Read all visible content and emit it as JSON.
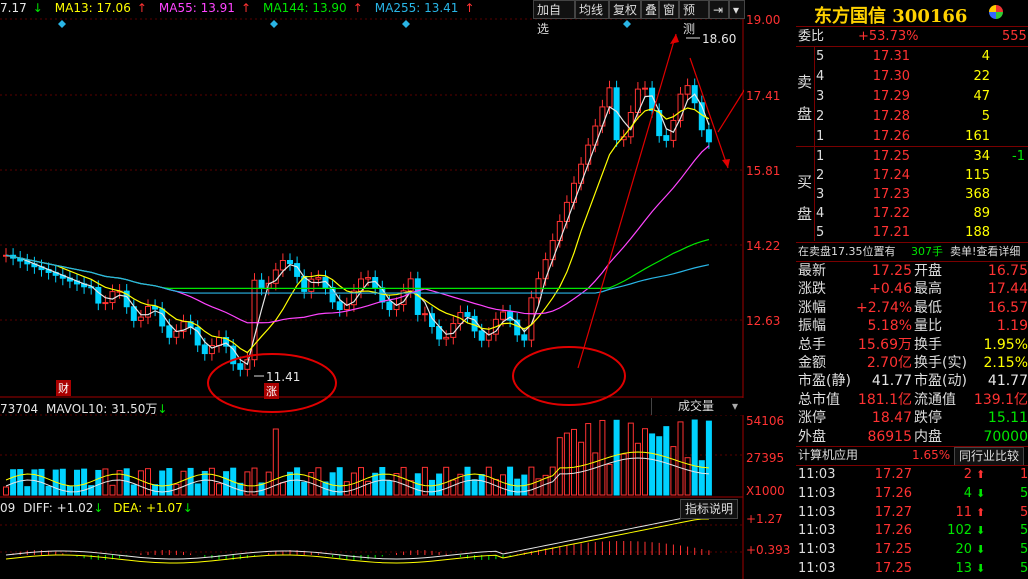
{
  "ma_legend": [
    {
      "label": "7.17",
      "arrow": "↓",
      "color": "#e6e6e6",
      "arrow_color": "#00e600"
    },
    {
      "label": "MA13: 17.06",
      "arrow": "↑",
      "color": "#ffff00",
      "arrow_color": "#ff3232"
    },
    {
      "label": "MA55: 13.91",
      "arrow": "↑",
      "color": "#ff44ff",
      "arrow_color": "#ff3232"
    },
    {
      "label": "MA144: 13.90",
      "arrow": "↑",
      "color": "#00e600",
      "arrow_color": "#ff3232"
    },
    {
      "label": "MA255: 13.41",
      "arrow": "↑",
      "color": "#29b5e6",
      "arrow_color": "#ff3232"
    }
  ],
  "toolbar": [
    "加自选",
    "均线",
    "复权",
    "叠",
    "窗",
    "预测"
  ],
  "price_axis": [
    "19.00",
    "17.41",
    "15.81",
    "14.22",
    "12.63"
  ],
  "annotations": {
    "high": "18.60",
    "low": "11.41",
    "zhang": "涨",
    "cai": "财"
  },
  "volume": {
    "legend_left": "73704",
    "mavol": "MAVOL10: 31.50万",
    "mavol_arrow": "↓",
    "select": "成交量",
    "axis": [
      "54106",
      "27395",
      "X1000"
    ]
  },
  "macd": {
    "legend_left": "09",
    "diff": "DIFF: +1.02",
    "diff_arrow": "↓",
    "dea": "DEA: +1.07",
    "dea_arrow": "↓",
    "button": "指标说明",
    "axis": [
      "+1.27",
      "+0.393"
    ]
  },
  "quote": {
    "name": "东方国信",
    "code": "300166",
    "weibi_label": "委比",
    "weibi": "+53.73%",
    "weibi_num": "555",
    "sell_label": [
      "卖",
      "盘"
    ],
    "buy_label": [
      "买",
      "盘"
    ],
    "sell": [
      {
        "lvl": "5",
        "price": "17.31",
        "vol": "4"
      },
      {
        "lvl": "4",
        "price": "17.30",
        "vol": "22"
      },
      {
        "lvl": "3",
        "price": "17.29",
        "vol": "47"
      },
      {
        "lvl": "2",
        "price": "17.28",
        "vol": "5"
      },
      {
        "lvl": "1",
        "price": "17.26",
        "vol": "161"
      }
    ],
    "buy": [
      {
        "lvl": "1",
        "price": "17.25",
        "vol": "34",
        "extra": "-1"
      },
      {
        "lvl": "2",
        "price": "17.24",
        "vol": "115",
        "extra": ""
      },
      {
        "lvl": "3",
        "price": "17.23",
        "vol": "368",
        "extra": ""
      },
      {
        "lvl": "4",
        "price": "17.22",
        "vol": "89",
        "extra": ""
      },
      {
        "lvl": "5",
        "price": "17.21",
        "vol": "188",
        "extra": ""
      }
    ],
    "notice": "在卖盘17.35位置有",
    "notice_vol": "307手",
    "notice_tail": "卖单!查看详细",
    "stats": [
      [
        "最新",
        "17.25",
        "red",
        "开盘",
        "16.75",
        "red"
      ],
      [
        "涨跌",
        "+0.46",
        "red",
        "最高",
        "17.44",
        "red"
      ],
      [
        "涨幅",
        "+2.74%",
        "red",
        "最低",
        "16.57",
        "red"
      ],
      [
        "振幅",
        "5.18%",
        "red",
        "量比",
        "1.19",
        "red"
      ],
      [
        "总手",
        "15.69万",
        "red",
        "换手",
        "1.95%",
        "yel"
      ],
      [
        "金额",
        "2.70亿",
        "red",
        "换手(实)",
        "2.15%",
        "yel"
      ],
      [
        "市盈(静)",
        "41.77",
        "wht",
        "市盈(动)",
        "41.77",
        "wht"
      ],
      [
        "总市值",
        "181.1亿",
        "red",
        "流通值",
        "139.1亿",
        "red"
      ],
      [
        "涨停",
        "18.47",
        "red",
        "跌停",
        "15.11",
        "grn"
      ],
      [
        "外盘",
        "86915",
        "red",
        "内盘",
        "70000",
        "grn"
      ]
    ],
    "industry_name": "计算机应用",
    "industry_pct": "1.65%",
    "industry_btn": "同行业比较",
    "ticks": [
      {
        "time": "11:03",
        "price": "17.27",
        "vol": "2",
        "dir": "up"
      },
      {
        "time": "11:03",
        "price": "17.26",
        "vol": "4",
        "dir": "down"
      },
      {
        "time": "11:03",
        "price": "17.27",
        "vol": "11",
        "dir": "up"
      },
      {
        "time": "11:03",
        "price": "17.26",
        "vol": "102",
        "dir": "down"
      },
      {
        "time": "11:03",
        "price": "17.25",
        "vol": "20",
        "dir": "down"
      },
      {
        "time": "11:03",
        "price": "17.25",
        "vol": "13",
        "dir": "down"
      }
    ],
    "tick_extra": [
      "1",
      "5",
      "5",
      "5",
      "5",
      "5"
    ]
  }
}
